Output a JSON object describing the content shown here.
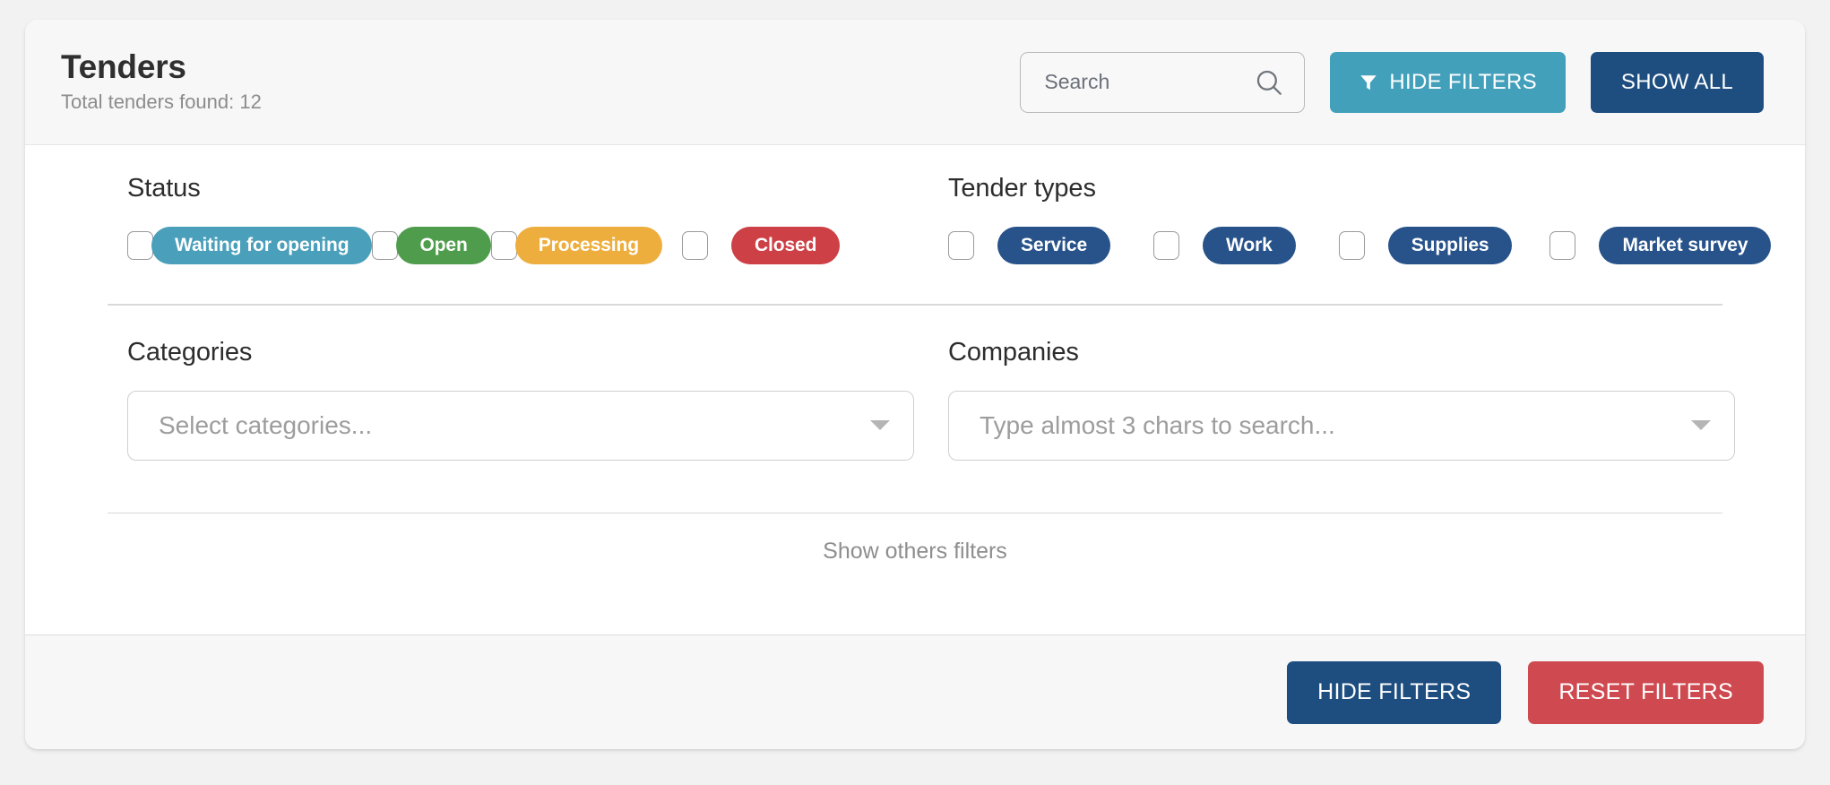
{
  "header": {
    "title": "Tenders",
    "subtitle": "Total tenders found: 12",
    "search": {
      "value": "",
      "placeholder": "Search",
      "icon": "search-icon"
    },
    "hide_filters_label": "HIDE FILTERS",
    "hide_filters_icon": "funnel-icon",
    "show_all_label": "SHOW ALL"
  },
  "filters": {
    "status": {
      "label": "Status",
      "options": [
        {
          "label": "Waiting for opening",
          "color": "#4a9fba",
          "checked": false
        },
        {
          "label": "Open",
          "color": "#4f9c4c",
          "checked": false
        },
        {
          "label": "Processing",
          "color": "#eeae3e",
          "checked": false
        },
        {
          "label": "Closed",
          "color": "#cc4046",
          "checked": false
        }
      ]
    },
    "tender_types": {
      "label": "Tender types",
      "options": [
        {
          "label": "Service",
          "color": "#27528a",
          "checked": false
        },
        {
          "label": "Work",
          "color": "#27528a",
          "checked": false
        },
        {
          "label": "Supplies",
          "color": "#27528a",
          "checked": false
        },
        {
          "label": "Market survey",
          "color": "#27528a",
          "checked": false
        }
      ]
    },
    "categories": {
      "label": "Categories",
      "placeholder": "Select categories...",
      "value": ""
    },
    "companies": {
      "label": "Companies",
      "placeholder": "Type almost 3 chars to search...",
      "value": ""
    },
    "show_others_label": "Show others filters"
  },
  "footer": {
    "hide_filters_label": "HIDE FILTERS",
    "reset_filters_label": "RESET FILTERS"
  },
  "colors": {
    "accent_teal": "#43a0bb",
    "navy": "#1e4e80",
    "red": "#cf4a50",
    "page_bg": "#f2f2f2",
    "panel_bg": "#f7f7f7"
  }
}
